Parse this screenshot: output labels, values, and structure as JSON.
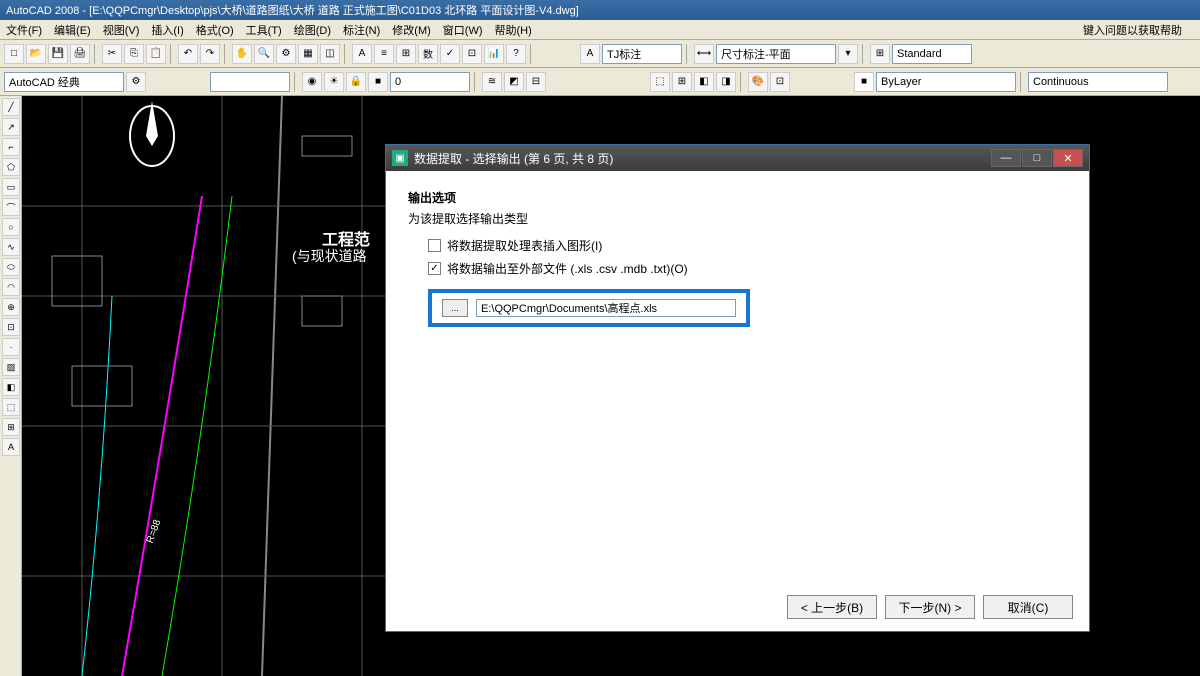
{
  "app": {
    "title": "AutoCAD 2008 - [E:\\QQPCmgr\\Desktop\\pjs\\大桥\\道路图纸\\大桥 道路 正式施工图\\C01D03 北环路 平面设计图-V4.dwg]"
  },
  "menu": {
    "items": [
      "文件(F)",
      "编辑(E)",
      "视图(V)",
      "插入(I)",
      "格式(O)",
      "工具(T)",
      "绘图(D)",
      "标注(N)",
      "修改(M)",
      "窗口(W)",
      "帮助(H)"
    ],
    "right_hint": "键入问题以获取帮助"
  },
  "toolbar1": {
    "style_input": "TJ标注",
    "dim_label": "尺寸标注-平面",
    "standard": "Standard"
  },
  "toolbar2": {
    "workspace": "AutoCAD 经典",
    "layer": "ByLayer",
    "linetype": "Continuous"
  },
  "canvas": {
    "label_project": "工程范",
    "label_road": "(与现状道路",
    "label_r": "R=88"
  },
  "dialog": {
    "title": "数据提取 - 选择输出 (第 6 页, 共 8 页)",
    "section_title": "输出选项",
    "section_sub": "为该提取选择输出类型",
    "option1": "将数据提取处理表插入图形(I)",
    "option2": "将数据输出至外部文件 (.xls .csv .mdb .txt)(O)",
    "browse_label": "...",
    "path_value": "E:\\QQPCmgr\\Documents\\高程点.xls",
    "btn_back": "< 上一步(B)",
    "btn_next": "下一步(N) >",
    "btn_cancel": "取消(C)"
  }
}
